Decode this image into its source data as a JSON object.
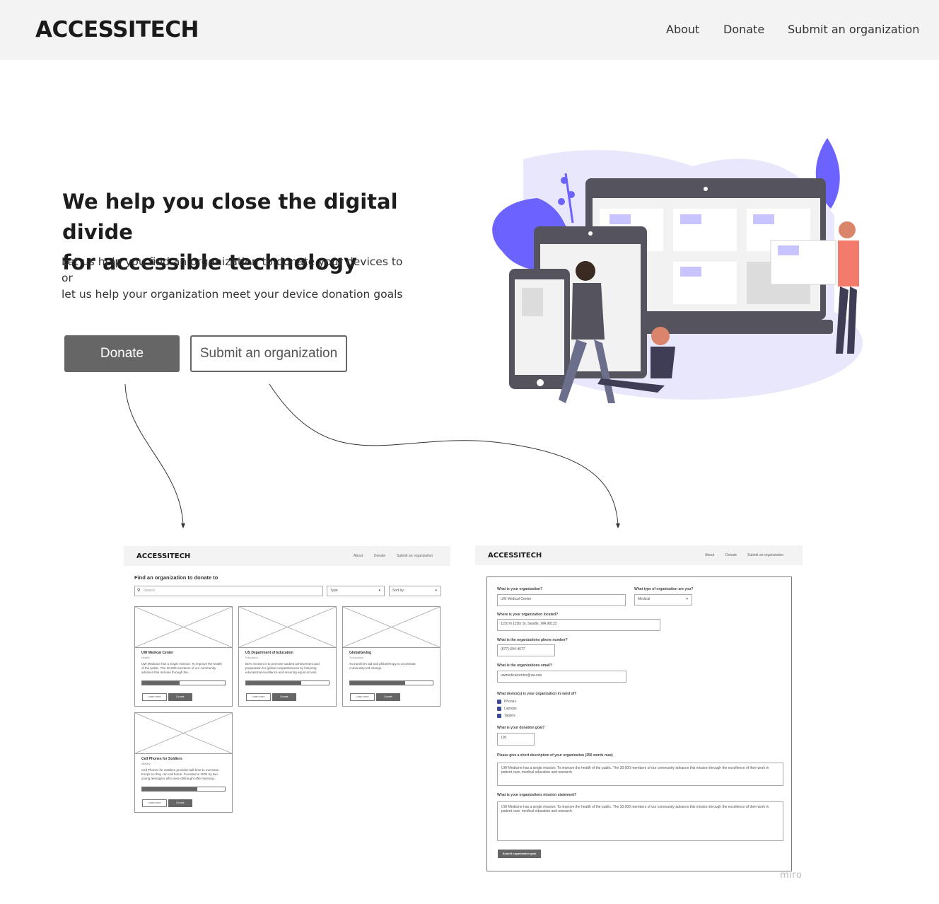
{
  "header": {
    "logo": "ACCESSITECH",
    "nav": [
      "About",
      "Donate",
      "Submit an organization"
    ]
  },
  "hero": {
    "title_line1": "We help you close the digital divide",
    "title_line2": "for accessible technology",
    "subtitle_line1": "Let us help you find an organization to donate your devices to or",
    "subtitle_line2": "let us help your organization meet your device donation goals",
    "donate_button": "Donate",
    "submit_button": "Submit an organization"
  },
  "donate_wireframe": {
    "logo": "ACCESSITECH",
    "nav": [
      "About",
      "Donate",
      "Submit an organization"
    ],
    "heading": "Find an organization to donate to",
    "search_placeholder": "Search",
    "type_select": "Type",
    "sort_select": "Sort by",
    "cards": [
      {
        "title": "UW Medical Center",
        "type": "Health",
        "desc": "UW Medicine has a single mission: To improve the health of the public. The 30,000 members of our community advance this mission through the...",
        "progress": 0.45,
        "learn": "Learn more",
        "donate": "Donate"
      },
      {
        "title": "US Department of Education",
        "type": "Education",
        "desc": "ED's mission is to promote student achievement and preparation for global competitiveness by fostering educational excellence and ensuring equal access.",
        "progress": 0.67,
        "learn": "Learn more",
        "donate": "Donate"
      },
      {
        "title": "GlobalGiving",
        "type": "Occupation",
        "desc": "To transform aid and philanthropy to accelerate community-led change.",
        "progress": 0.67,
        "learn": "Learn more",
        "donate": "Donate"
      },
      {
        "title": "Cell Phones for Soldiers",
        "type": "Military",
        "desc": "Cell Phones for Soldiers provides talk time to overseas troops so they can call home. Founded in 2004 by two young teenagers who were distraught after learning...",
        "progress": 0.67,
        "learn": "Learn more",
        "donate": "Donate"
      }
    ]
  },
  "submit_wireframe": {
    "logo": "ACCESSITECH",
    "nav": [
      "About",
      "Donate",
      "Submit an organization"
    ],
    "q_org": "What is your organization?",
    "v_org": "UW Medical Center",
    "q_type": "What type of organization are you?",
    "v_type": "Medical",
    "q_location": "Where is your organization located?",
    "v_location": "1150 N 115th St, Seattle, WA 98133",
    "q_phone": "What is the organizations phone number?",
    "v_phone": "(877)-694-4677",
    "q_email": "What is the organizations email?",
    "v_email": "uwmedicalcenter@uw.edu",
    "q_devices": "What device(s) is your organization in need of?",
    "devices": [
      "Phones",
      "Laptops",
      "Tablets"
    ],
    "q_goal": "What is your donation goal?",
    "v_goal": "100",
    "q_desc": "Please give a short description of your organization (256 words max)",
    "v_desc": "UW Medicine has a single mission: To improve the health of the public. The 30,000 members of our community advance this mission through the excellence of their work in patient care, medical education and research.",
    "q_mission": "What is your organizations mission statement?",
    "v_mission": "UW Medicine has a single mission: To improve the health of the public. The 30,000 members of our community advance this mission through the excellence of their work in patient care, medical education and research.",
    "submit": "Submit organization goal"
  },
  "watermark": "miro",
  "colors": {
    "accent": "#6c63ff",
    "button_gray": "#666666",
    "header_bg": "#f3f3f3"
  }
}
